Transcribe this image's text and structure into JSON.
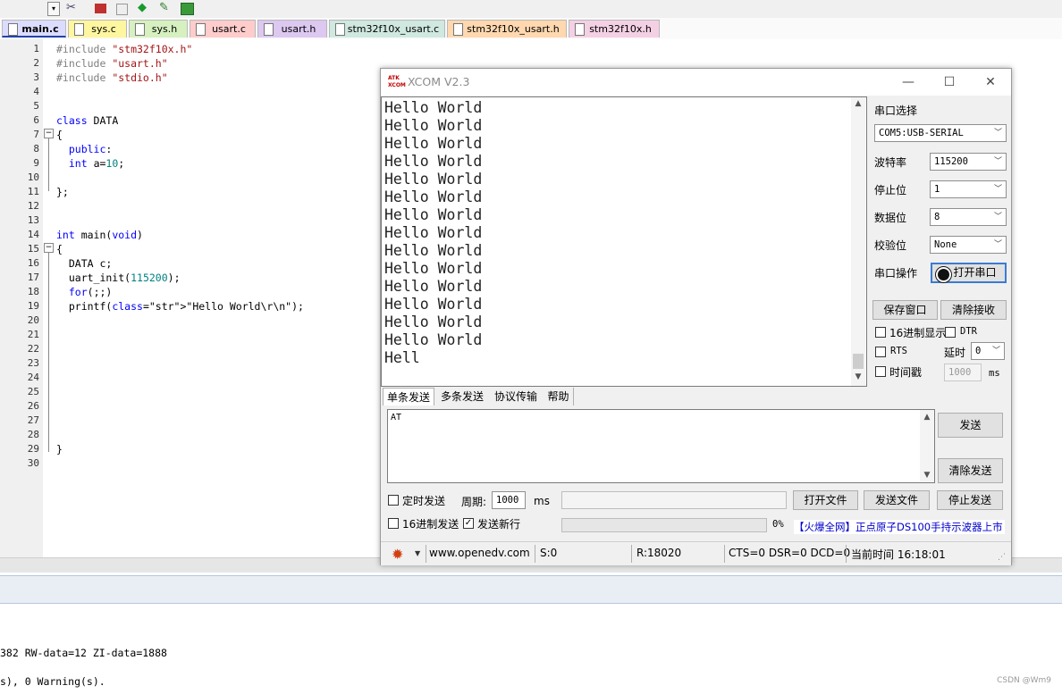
{
  "toolbar": {
    "icons": [
      "dropdown-icon",
      "wrench-icon",
      "component-icon",
      "bookmark-icon",
      "diamond-icon",
      "build-icon",
      "cube-icon"
    ]
  },
  "tabs": [
    {
      "label": "main.c",
      "color": "#dcdcff",
      "active": true
    },
    {
      "label": "sys.c",
      "color": "#fff6a0"
    },
    {
      "label": "sys.h",
      "color": "#d6f0c0"
    },
    {
      "label": "usart.c",
      "color": "#ffcccc"
    },
    {
      "label": "usart.h",
      "color": "#dcc8f0"
    },
    {
      "label": "stm32f10x_usart.c",
      "color": "#cfe8e0"
    },
    {
      "label": "stm32f10x_usart.h",
      "color": "#ffd8b0"
    },
    {
      "label": "stm32f10x.h",
      "color": "#f4d0e4"
    }
  ],
  "editor": {
    "line_numbers": [
      "1",
      "2",
      "3",
      "4",
      "5",
      "6",
      "7",
      "8",
      "9",
      "10",
      "11",
      "12",
      "13",
      "14",
      "15",
      "16",
      "17",
      "18",
      "19",
      "20",
      "21",
      "22",
      "23",
      "24",
      "25",
      "26",
      "27",
      "28",
      "29",
      "30"
    ],
    "code": [
      {
        "line": 1,
        "text": "#include \"stm32f10x.h\""
      },
      {
        "line": 2,
        "text": "#include \"usart.h\""
      },
      {
        "line": 3,
        "text": "#include \"stdio.h\""
      },
      {
        "line": 6,
        "text": "class DATA"
      },
      {
        "line": 7,
        "text": "{"
      },
      {
        "line": 8,
        "text": "  public:"
      },
      {
        "line": 9,
        "text": "  int a=10;"
      },
      {
        "line": 11,
        "text": "};"
      },
      {
        "line": 14,
        "text": "int main(void)"
      },
      {
        "line": 15,
        "text": "{"
      },
      {
        "line": 16,
        "text": "  DATA c;"
      },
      {
        "line": 17,
        "text": "  uart_init(115200);"
      },
      {
        "line": 18,
        "text": "  for(;;)"
      },
      {
        "line": 19,
        "text": "  printf(\"Hello World\\r\\n\");"
      },
      {
        "line": 29,
        "text": "}"
      }
    ]
  },
  "build_output": {
    "line1": "382 RW-data=12 ZI-data=1888",
    "line2": "s), 0 Warning(s)."
  },
  "watermark": "CSDN @Wm9",
  "xcom": {
    "title": "XCOM V2.3",
    "logo": "ATK XCOM",
    "receive_lines": [
      "Hello World",
      "Hello World",
      "Hello World",
      "Hello World",
      "Hello World",
      "Hello World",
      "Hello World",
      "Hello World",
      "Hello World",
      "Hello World",
      "Hello World",
      "Hello World",
      "Hello World",
      "Hello World",
      "Hell"
    ],
    "port_label": "串口选择",
    "port_value": "COM5:USB-SERIAL",
    "baud_label": "波特率",
    "baud_value": "115200",
    "stopbits_label": "停止位",
    "stopbits_value": "1",
    "databits_label": "数据位",
    "databits_value": "8",
    "parity_label": "校验位",
    "parity_value": "None",
    "serial_op_label": "串口操作",
    "open_port_button": "打开串口",
    "save_window_button": "保存窗口",
    "clear_receive_button": "清除接收",
    "hex_display_label": "16进制显示",
    "dtr_label": "DTR",
    "rts_label": "RTS",
    "delay_label": "延时",
    "delay_value": "0",
    "timestamp_label": "时间戳",
    "timestamp_value": "1000",
    "ms_label": "ms",
    "send_tabs": [
      "单条发送",
      "多条发送",
      "协议传输",
      "帮助"
    ],
    "send_text": "AT",
    "send_button": "发送",
    "clear_send_button": "清除发送",
    "timed_send_label": "定时发送",
    "period_label": "周期:",
    "period_value": "1000",
    "period_unit": "ms",
    "open_file_button": "打开文件",
    "send_file_button": "发送文件",
    "stop_send_button": "停止发送",
    "hex_send_label": "16进制发送",
    "newline_label": "发送新行",
    "newline_checked": true,
    "progress_percent": "0%",
    "progress_value": 0,
    "promo_link": "【火爆全网】正点原子DS100手持示波器上市",
    "status": {
      "website": "www.openedv.com",
      "sent": "S:0",
      "received": "R:18020",
      "lines": "CTS=0 DSR=0 DCD=0",
      "time": "当前时间 16:18:01"
    }
  }
}
